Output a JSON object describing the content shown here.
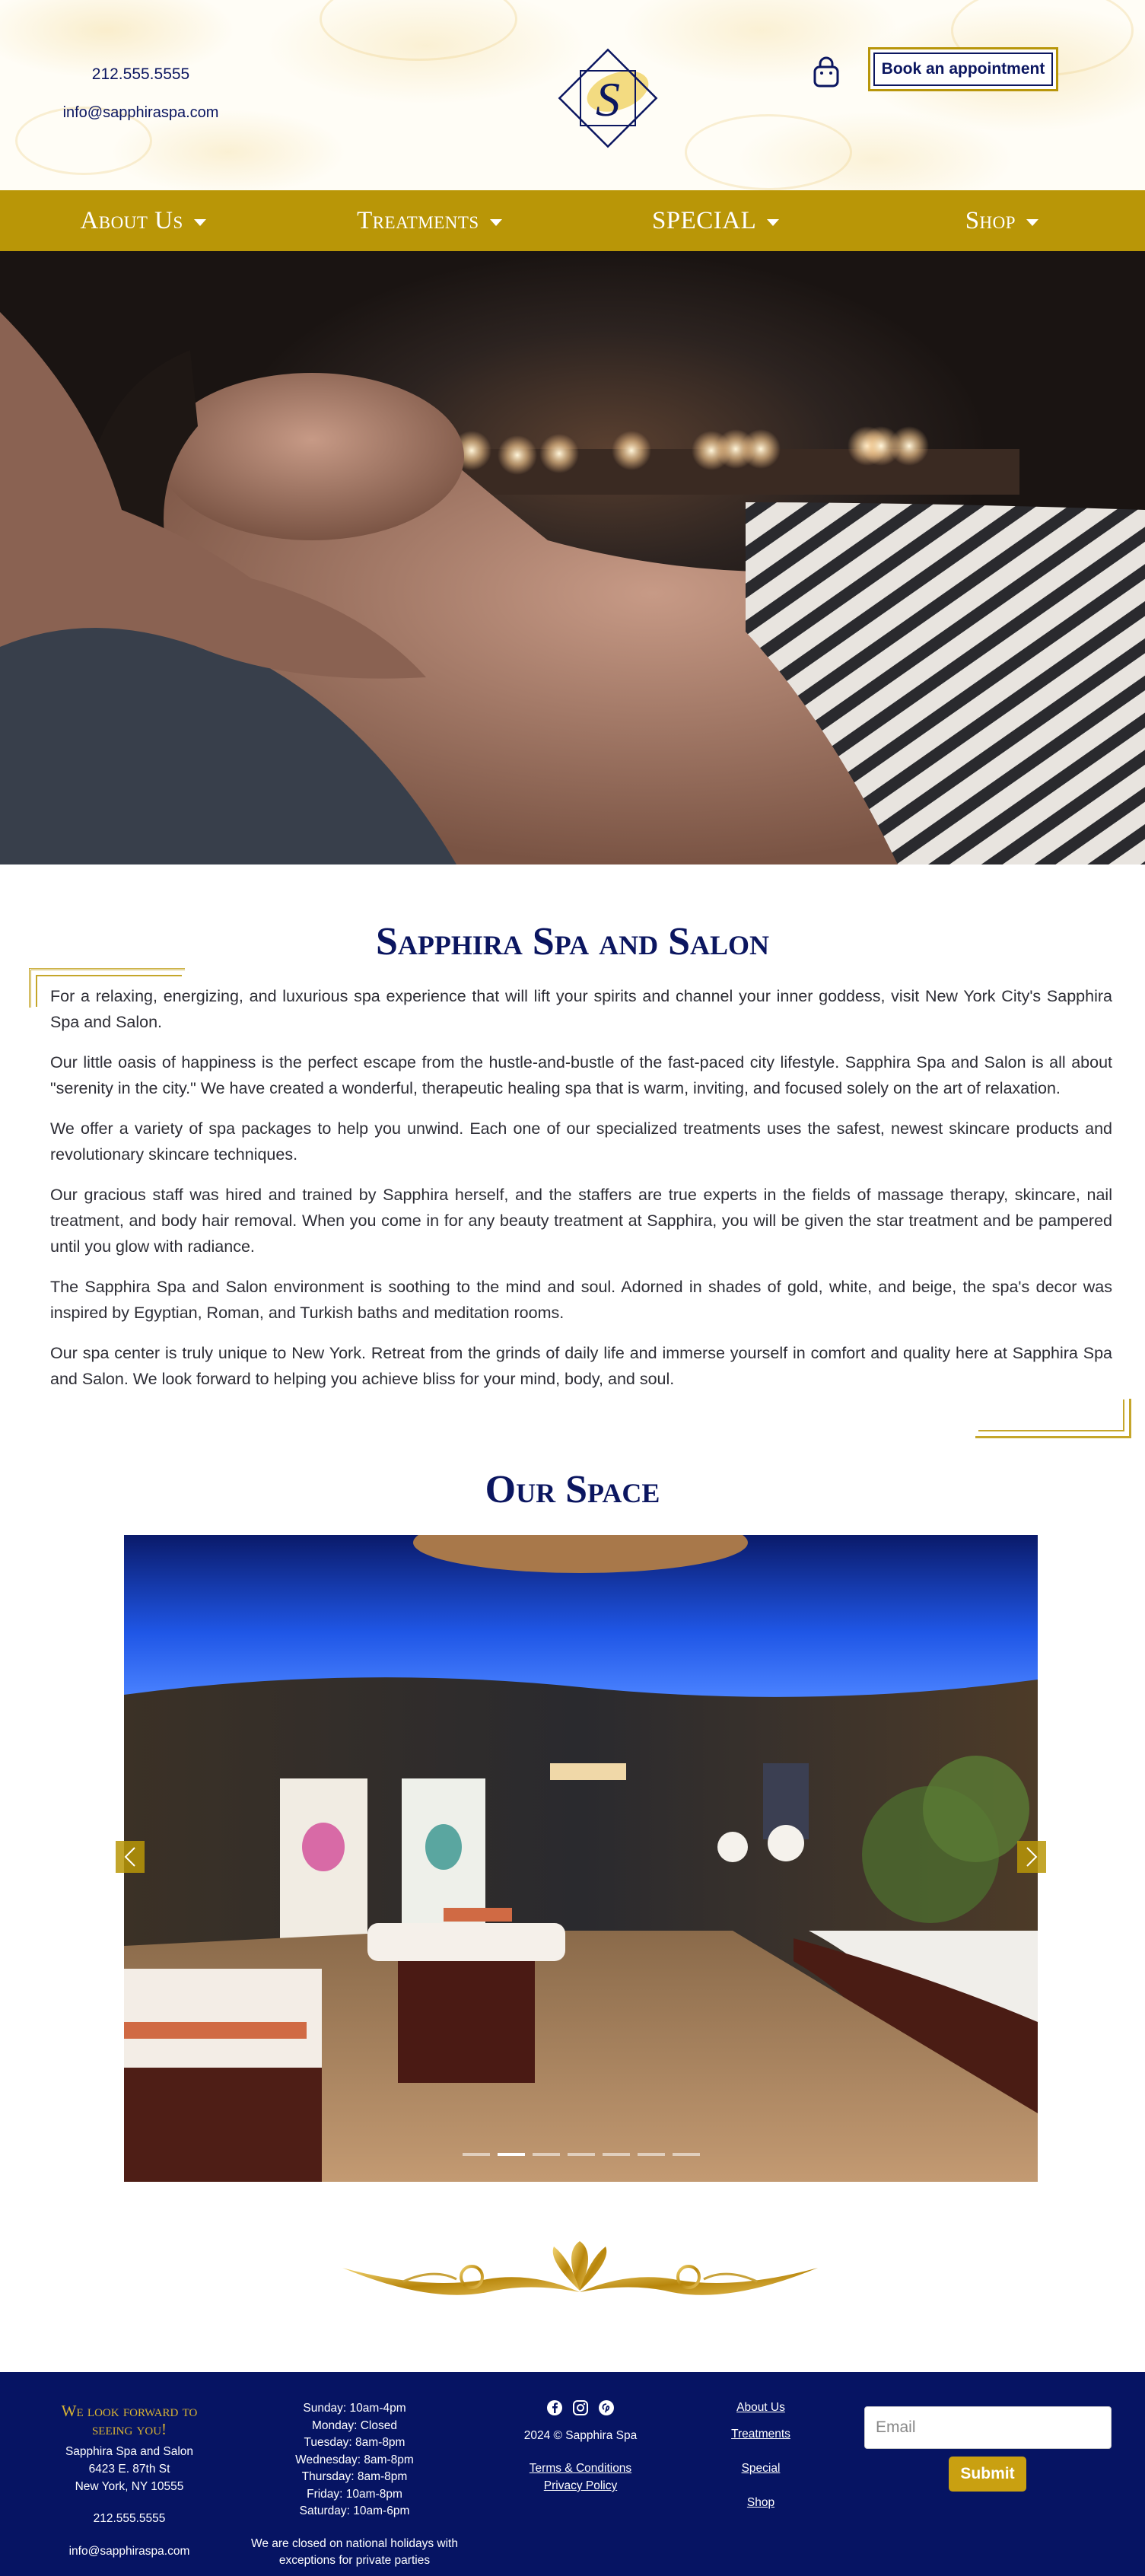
{
  "header": {
    "phone": "212.555.5555",
    "email": "info@sapphiraspa.com",
    "logo_letter": "S",
    "book_label": "Book an appointment",
    "bag_icon": "shopping-bag-icon"
  },
  "nav": {
    "items": [
      {
        "label": "About Us"
      },
      {
        "label": "Treatments"
      },
      {
        "label": "SPECIAL"
      },
      {
        "label": "Shop"
      }
    ]
  },
  "intro": {
    "title": "Sapphira Spa and Salon",
    "paragraphs": [
      "For a relaxing, energizing, and luxurious spa experience that will lift your spirits and channel your inner goddess, visit New York City's Sapphira Spa and Salon.",
      "Our little oasis of happiness is the perfect escape from the hustle-and-bustle of the fast-paced city lifestyle. Sapphira Spa and Salon is all about \"serenity in the city.\" We have created a wonderful, therapeutic healing spa that is warm, inviting, and focused solely on the art of relaxation.",
      "We offer a variety of spa packages to help you unwind. Each one of our specialized treatments uses the safest, newest skincare products and revolutionary skincare techniques.",
      "Our gracious staff was hired and trained by Sapphira herself, and the staffers are true experts in the fields of massage therapy, skincare, nail treatment, and body hair removal. When you come in for any beauty treatment at Sapphira, you will be given the star treatment and be pampered until you glow with radiance.",
      "The Sapphira Spa and Salon environment is soothing to the mind and soul. Adorned in shades of gold, white, and beige, the spa's decor was inspired by Egyptian, Roman, and Turkish baths and meditation rooms.",
      "Our spa center is truly unique to New York. Retreat from the grinds of daily life and immerse yourself in comfort and quality here at Sapphira Spa and Salon. We look forward to helping you achieve bliss for your mind, body, and soul."
    ]
  },
  "space": {
    "title": "Our Space",
    "slide_count": 7,
    "active_slide": 2
  },
  "footer": {
    "tagline": "We look forward to seeing you!",
    "business_name": "Sapphira Spa and Salon",
    "address_line1": "6423 E. 87th St",
    "address_line2": "New York, NY 10555",
    "phone": "212.555.5555",
    "email": "info@sapphiraspa.com",
    "hours": [
      "Sunday: 10am-4pm",
      "Monday: Closed",
      "Tuesday: 8am-8pm",
      "Wednesday: 8am-8pm",
      "Thursday: 8am-8pm",
      "Friday: 10am-8pm",
      "Saturday: 10am-6pm"
    ],
    "holiday_note": "We are closed on national holidays with exceptions for private parties",
    "copyright": "2024 © Sapphira Spa",
    "terms": "Terms & Conditions",
    "privacy": "Privacy Policy",
    "links": [
      "About Us",
      "Treatments",
      "Special",
      "Shop"
    ],
    "email_placeholder": "Email",
    "submit_label": "Submit",
    "social_icons": [
      "facebook-icon",
      "instagram-icon",
      "pinterest-icon"
    ]
  },
  "colors": {
    "navy": "#0b1660",
    "gold": "#b99607",
    "footer_bg": "#061463"
  }
}
